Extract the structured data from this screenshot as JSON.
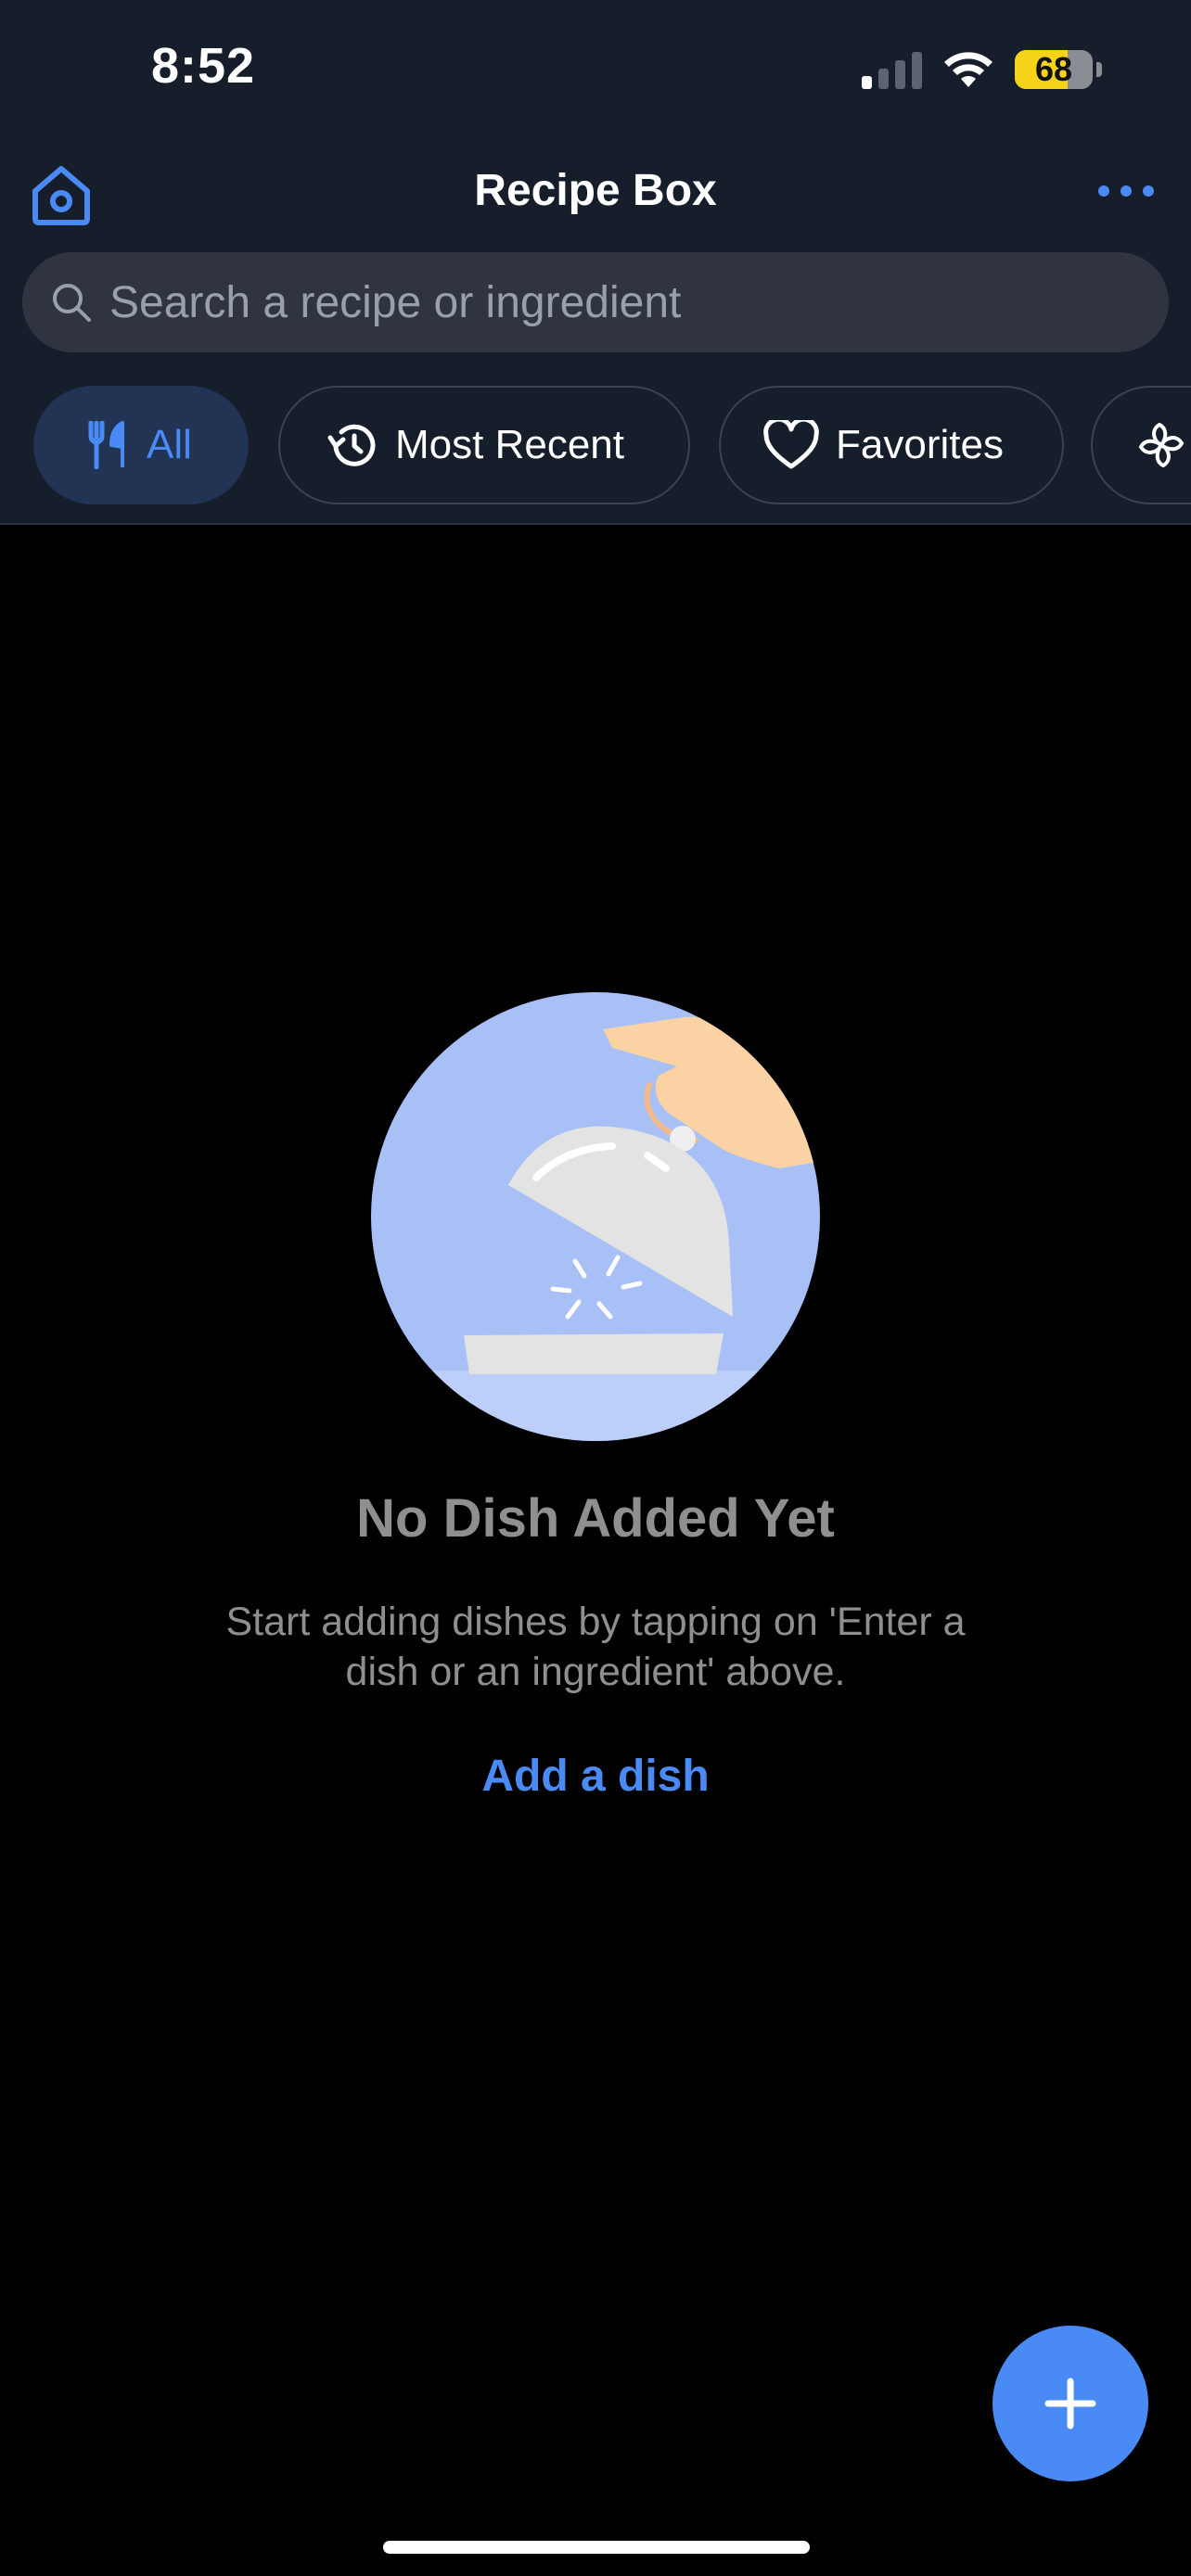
{
  "status_bar": {
    "time": "8:52",
    "battery_level": "68",
    "battery_fraction": 0.68,
    "signal_bars_active": 1,
    "signal_bars_total": 4
  },
  "header": {
    "title": "Recipe Box",
    "home_icon": "home-icon",
    "more_icon": "more-horizontal-icon"
  },
  "search": {
    "placeholder": "Search a recipe or ingredient",
    "value": "",
    "icon": "search-icon"
  },
  "filters": [
    {
      "label": "All",
      "icon": "fork-knife-icon",
      "active": true
    },
    {
      "label": "Most Recent",
      "icon": "history-icon",
      "active": false
    },
    {
      "label": "Favorites",
      "icon": "heart-icon",
      "active": false
    },
    {
      "label": "",
      "icon": "pinwheel-icon",
      "active": false
    }
  ],
  "empty_state": {
    "title": "No Dish Added Yet",
    "description": "Start adding dishes by tapping on 'Enter a dish or an ingredient' above.",
    "action_label": "Add a dish",
    "illustration": "serving-cloche-illustration"
  },
  "fab": {
    "icon": "plus-icon"
  },
  "colors": {
    "accent": "#4a8af4",
    "header_bg": "#161d2b",
    "active_chip_bg": "#223353",
    "background": "#000000",
    "muted_text": "#8f8f8f",
    "battery": "#f5d31b"
  }
}
